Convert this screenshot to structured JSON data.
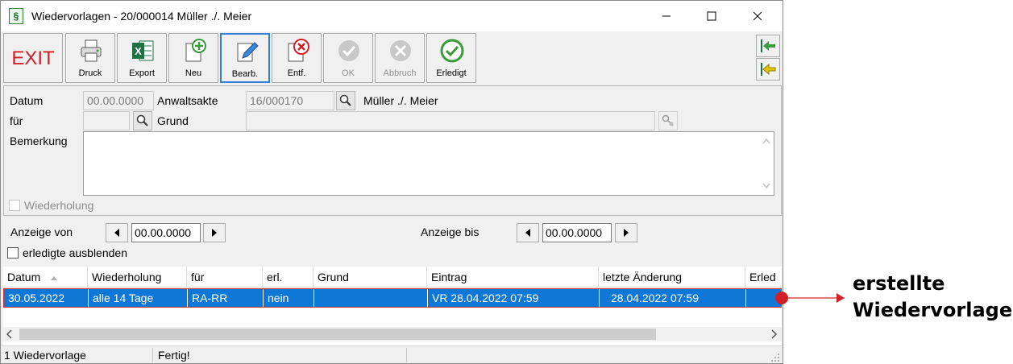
{
  "window": {
    "title": "Wiedervorlagen - 20/000014 Müller ./. Meier",
    "app_icon": "§"
  },
  "toolbar": {
    "exit_label": "EXIT",
    "buttons": [
      {
        "label": "Druck",
        "icon": "printer-icon"
      },
      {
        "label": "Export",
        "icon": "excel-icon"
      },
      {
        "label": "Neu",
        "icon": "new-document-icon"
      },
      {
        "label": "Bearb.",
        "icon": "edit-pencil-icon"
      },
      {
        "label": "Entf.",
        "icon": "delete-icon"
      },
      {
        "label": "OK",
        "icon": "check-icon"
      },
      {
        "label": "Abbruch",
        "icon": "cancel-icon"
      },
      {
        "label": "Erledigt",
        "icon": "done-check-icon"
      }
    ]
  },
  "form": {
    "datum_label": "Datum",
    "datum_value": "00.00.0000",
    "anwaltsakte_label": "Anwaltsakte",
    "anwaltsakte_value": "16/000170",
    "akte_name": "Müller ./. Meier",
    "fuer_label": "für",
    "grund_label": "Grund",
    "bemerkung_label": "Bemerkung",
    "wiederholung_label": "Wiederholung"
  },
  "filter": {
    "von_label": "Anzeige von",
    "von_value": "00.00.0000",
    "bis_label": "Anzeige bis",
    "bis_value": "00.00.0000",
    "hide_done_label": "erledigte ausblenden"
  },
  "grid": {
    "columns": [
      "Datum",
      "Wiederholung",
      "für",
      "erl.",
      "Grund",
      "Eintrag",
      "letzte Änderung",
      "Erled"
    ],
    "rows": [
      [
        "30.05.2022",
        "alle 14 Tage",
        "RA-RR",
        "nein",
        "",
        "VR 28.04.2022  07:59",
        "28.04.2022  07:59",
        ""
      ]
    ]
  },
  "status": {
    "count": "1 Wiedervorlage",
    "state": "Fertig!"
  },
  "annotation": {
    "line1": "erstellte",
    "line2": "Wiedervorlage"
  },
  "colors": {
    "selection": "#0f78d7",
    "marker": "#d32027",
    "exit": "#d32027"
  }
}
